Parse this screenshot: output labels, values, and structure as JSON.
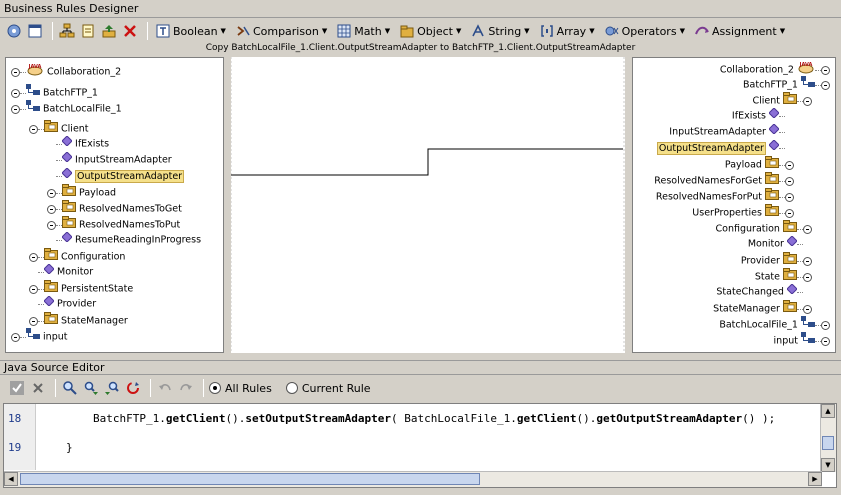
{
  "window": {
    "title": "Business Rules Designer"
  },
  "toolbar": {
    "menus": [
      {
        "label": "Boolean",
        "icon": "boolean-icon"
      },
      {
        "label": "Comparison",
        "icon": "comparison-icon"
      },
      {
        "label": "Math",
        "icon": "math-icon"
      },
      {
        "label": "Object",
        "icon": "object-icon"
      },
      {
        "label": "String",
        "icon": "string-icon"
      },
      {
        "label": "Array",
        "icon": "array-icon"
      },
      {
        "label": "Operators",
        "icon": "operators-icon"
      },
      {
        "label": "Assignment",
        "icon": "assignment-icon"
      }
    ]
  },
  "rule_description": "Copy BatchLocalFile_1.Client.OutputStreamAdapter to BatchFTP_1.Client.OutputStreamAdapter",
  "left_tree": [
    {
      "label": "Collaboration_2",
      "icon": "java-icon",
      "level": 0
    },
    {
      "label": "BatchFTP_1",
      "icon": "component-icon",
      "level": 0
    },
    {
      "label": "BatchLocalFile_1",
      "icon": "component-icon",
      "level": 0
    },
    {
      "label": "Client",
      "icon": "folder-icon",
      "level": 1
    },
    {
      "label": "IfExists",
      "icon": "property-icon",
      "level": 2
    },
    {
      "label": "InputStreamAdapter",
      "icon": "property-icon",
      "level": 2
    },
    {
      "label": "OutputStreamAdapter",
      "icon": "property-icon",
      "level": 2,
      "selected": true
    },
    {
      "label": "Payload",
      "icon": "folder-icon",
      "level": 2
    },
    {
      "label": "ResolvedNamesToGet",
      "icon": "folder-icon",
      "level": 2
    },
    {
      "label": "ResolvedNamesToPut",
      "icon": "folder-icon",
      "level": 2
    },
    {
      "label": "ResumeReadingInProgress",
      "icon": "property-icon",
      "level": 2
    },
    {
      "label": "Configuration",
      "icon": "folder-icon",
      "level": 1
    },
    {
      "label": "Monitor",
      "icon": "property-icon",
      "level": 1
    },
    {
      "label": "PersistentState",
      "icon": "folder-icon",
      "level": 1
    },
    {
      "label": "Provider",
      "icon": "property-icon",
      "level": 1
    },
    {
      "label": "StateManager",
      "icon": "folder-icon",
      "level": 1
    },
    {
      "label": "input",
      "icon": "component-icon",
      "level": 0
    }
  ],
  "right_tree": [
    {
      "label": "Collaboration_2",
      "icon": "java-icon",
      "level": 0
    },
    {
      "label": "BatchFTP_1",
      "icon": "component-icon",
      "level": 0
    },
    {
      "label": "Client",
      "icon": "folder-icon",
      "level": 1
    },
    {
      "label": "IfExists",
      "icon": "property-icon",
      "level": 2
    },
    {
      "label": "InputStreamAdapter",
      "icon": "property-icon",
      "level": 2
    },
    {
      "label": "OutputStreamAdapter",
      "icon": "property-icon",
      "level": 2,
      "selected": true
    },
    {
      "label": "Payload",
      "icon": "folder-icon",
      "level": 2
    },
    {
      "label": "ResolvedNamesForGet",
      "icon": "folder-icon",
      "level": 2
    },
    {
      "label": "ResolvedNamesForPut",
      "icon": "folder-icon",
      "level": 2
    },
    {
      "label": "UserProperties",
      "icon": "folder-icon",
      "level": 2
    },
    {
      "label": "Configuration",
      "icon": "folder-icon",
      "level": 1
    },
    {
      "label": "Monitor",
      "icon": "property-icon",
      "level": 1
    },
    {
      "label": "Provider",
      "icon": "folder-icon",
      "level": 1
    },
    {
      "label": "State",
      "icon": "folder-icon",
      "level": 1
    },
    {
      "label": "StateChanged",
      "icon": "property-icon",
      "level": 1
    },
    {
      "label": "StateManager",
      "icon": "folder-icon",
      "level": 1
    },
    {
      "label": "BatchLocalFile_1",
      "icon": "component-icon",
      "level": 0
    },
    {
      "label": "input",
      "icon": "component-icon",
      "level": 0
    }
  ],
  "editor": {
    "title": "Java Source Editor",
    "all_rules_label": "All Rules",
    "current_rule_label": "Current Rule",
    "scope": "All Rules",
    "lines": [
      {
        "number": "18",
        "code": "BatchFTP_1.getClient().setOutputStreamAdapter( BatchLocalFile_1.getClient().getOutputStreamAdapter() );"
      },
      {
        "number": "19",
        "code": "}"
      }
    ]
  },
  "colors": {
    "window_bg": "#d4d0c8",
    "selection_highlight": "#f5e08a",
    "property_diamond": "#8a6fd6",
    "folder": "#e0b040",
    "line_number": "#1f3c8c"
  }
}
